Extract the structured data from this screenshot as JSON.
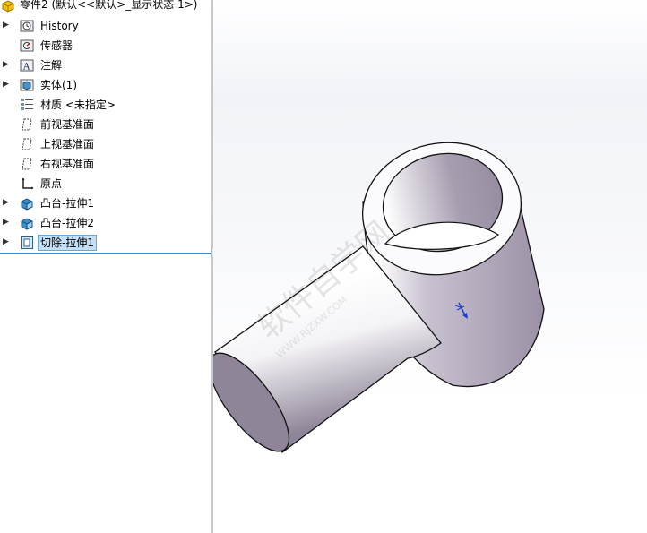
{
  "feature_tree": {
    "root_label": "零件2  (默认<<默认>_显示状态 1>)",
    "items": [
      {
        "label": "History",
        "icon": "history-icon",
        "expandable": true
      },
      {
        "label": "传感器",
        "icon": "sensor-icon",
        "expandable": false
      },
      {
        "label": "注解",
        "icon": "annotation-icon",
        "expandable": true
      },
      {
        "label": "实体(1)",
        "icon": "solid-bodies-icon",
        "expandable": true
      },
      {
        "label": "材质 <未指定>",
        "icon": "material-icon",
        "expandable": false
      },
      {
        "label": "前视基准面",
        "icon": "plane-icon",
        "expandable": false
      },
      {
        "label": "上视基准面",
        "icon": "plane-icon",
        "expandable": false
      },
      {
        "label": "右视基准面",
        "icon": "plane-icon",
        "expandable": false
      },
      {
        "label": "原点",
        "icon": "origin-icon",
        "expandable": false
      },
      {
        "label": "凸台-拉伸1",
        "icon": "boss-extrude-icon",
        "expandable": true
      },
      {
        "label": "凸台-拉伸2",
        "icon": "boss-extrude-icon",
        "expandable": true
      },
      {
        "label": "切除-拉伸1",
        "icon": "cut-extrude-icon",
        "expandable": true,
        "selected": true
      }
    ]
  },
  "viewport": {
    "watermark": "软件自学网",
    "watermark_url": "WWW.RJZXW.COM"
  },
  "colors": {
    "selection": "#c4e0f6",
    "selection_line": "#3b87c4",
    "part_dark": "#9d92a6",
    "part_light": "#ffffff"
  }
}
